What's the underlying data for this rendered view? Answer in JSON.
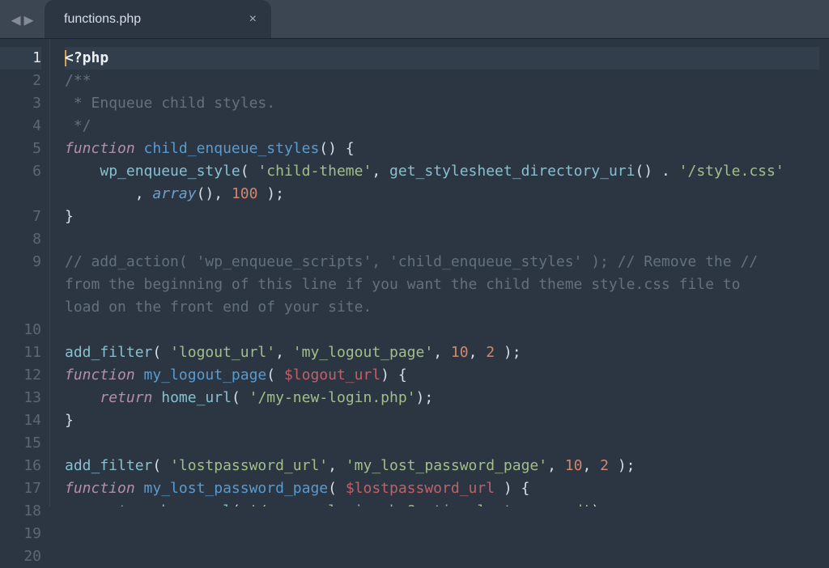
{
  "tab": {
    "title": "functions.php",
    "close_glyph": "×"
  },
  "nav": {
    "back_glyph": "◀",
    "forward_glyph": "▶"
  },
  "line_numbers": [
    "1",
    "2",
    "3",
    "4",
    "5",
    "6",
    "",
    "7",
    "8",
    "9",
    "",
    "",
    "10",
    "11",
    "12",
    "13",
    "14",
    "15",
    "16",
    "17",
    "18",
    "19",
    "20"
  ],
  "active_line_index": 0,
  "code": [
    [
      [
        "cursor-bar",
        ""
      ],
      [
        "c-tag",
        "<?php"
      ]
    ],
    [
      [
        "c-cmt",
        "/**"
      ]
    ],
    [
      [
        "c-cmt",
        " * Enqueue child styles."
      ]
    ],
    [
      [
        "c-cmt",
        " */"
      ]
    ],
    [
      [
        "c-kw",
        "function"
      ],
      [
        "c-pl",
        " "
      ],
      [
        "c-fnname",
        "child_enqueue_styles"
      ],
      [
        "c-pl",
        "() {"
      ]
    ],
    [
      [
        "c-pl",
        "    "
      ],
      [
        "c-call",
        "wp_enqueue_style"
      ],
      [
        "c-pl",
        "( "
      ],
      [
        "c-str",
        "'child-theme'"
      ],
      [
        "c-pl",
        ", "
      ],
      [
        "c-call",
        "get_stylesheet_directory_uri"
      ],
      [
        "c-pl",
        "() . "
      ],
      [
        "c-str",
        "'/style.css'"
      ]
    ],
    [
      [
        "c-pl",
        "        , "
      ],
      [
        "c-builtin",
        "array"
      ],
      [
        "c-pl",
        "(), "
      ],
      [
        "c-num",
        "100"
      ],
      [
        "c-pl",
        " );"
      ]
    ],
    [
      [
        "c-pl",
        "}"
      ]
    ],
    [
      [
        "c-pl",
        ""
      ]
    ],
    [
      [
        "c-cmt",
        "// add_action( 'wp_enqueue_scripts', 'child_enqueue_styles' ); // Remove the // "
      ]
    ],
    [
      [
        "c-cmt",
        "from the beginning of this line if you want the child theme style.css file to "
      ]
    ],
    [
      [
        "c-cmt",
        "load on the front end of your site."
      ]
    ],
    [
      [
        "c-pl",
        ""
      ]
    ],
    [
      [
        "c-call",
        "add_filter"
      ],
      [
        "c-pl",
        "( "
      ],
      [
        "c-str",
        "'logout_url'"
      ],
      [
        "c-pl",
        ", "
      ],
      [
        "c-str",
        "'my_logout_page'"
      ],
      [
        "c-pl",
        ", "
      ],
      [
        "c-num",
        "10"
      ],
      [
        "c-pl",
        ", "
      ],
      [
        "c-num",
        "2"
      ],
      [
        "c-pl",
        " );"
      ]
    ],
    [
      [
        "c-kw",
        "function"
      ],
      [
        "c-pl",
        " "
      ],
      [
        "c-fnname",
        "my_logout_page"
      ],
      [
        "c-pl",
        "( "
      ],
      [
        "c-var",
        "$logout_url"
      ],
      [
        "c-pl",
        ") {"
      ]
    ],
    [
      [
        "c-pl",
        "    "
      ],
      [
        "c-kw",
        "return"
      ],
      [
        "c-pl",
        " "
      ],
      [
        "c-call",
        "home_url"
      ],
      [
        "c-pl",
        "( "
      ],
      [
        "c-str",
        "'/my-new-login.php'"
      ],
      [
        "c-pl",
        ");"
      ]
    ],
    [
      [
        "c-pl",
        "}"
      ]
    ],
    [
      [
        "c-pl",
        ""
      ]
    ],
    [
      [
        "c-call",
        "add_filter"
      ],
      [
        "c-pl",
        "( "
      ],
      [
        "c-str",
        "'lostpassword_url'"
      ],
      [
        "c-pl",
        ", "
      ],
      [
        "c-str",
        "'my_lost_password_page'"
      ],
      [
        "c-pl",
        ", "
      ],
      [
        "c-num",
        "10"
      ],
      [
        "c-pl",
        ", "
      ],
      [
        "c-num",
        "2"
      ],
      [
        "c-pl",
        " );"
      ]
    ],
    [
      [
        "c-kw",
        "function"
      ],
      [
        "c-pl",
        " "
      ],
      [
        "c-fnname",
        "my_lost_password_page"
      ],
      [
        "c-pl",
        "( "
      ],
      [
        "c-var",
        "$lostpassword_url"
      ],
      [
        "c-pl",
        " ) {"
      ]
    ],
    [
      [
        "c-pl",
        "    "
      ],
      [
        "c-kw",
        "return"
      ],
      [
        "c-pl",
        " "
      ],
      [
        "c-call",
        "home_url"
      ],
      [
        "c-pl",
        "( "
      ],
      [
        "c-str",
        "'/my-new-login.php?action=lostpassword'"
      ],
      [
        "c-pl",
        ");"
      ]
    ],
    [
      [
        "c-pl",
        "}"
      ]
    ],
    [
      [
        "c-pl",
        ""
      ]
    ]
  ]
}
